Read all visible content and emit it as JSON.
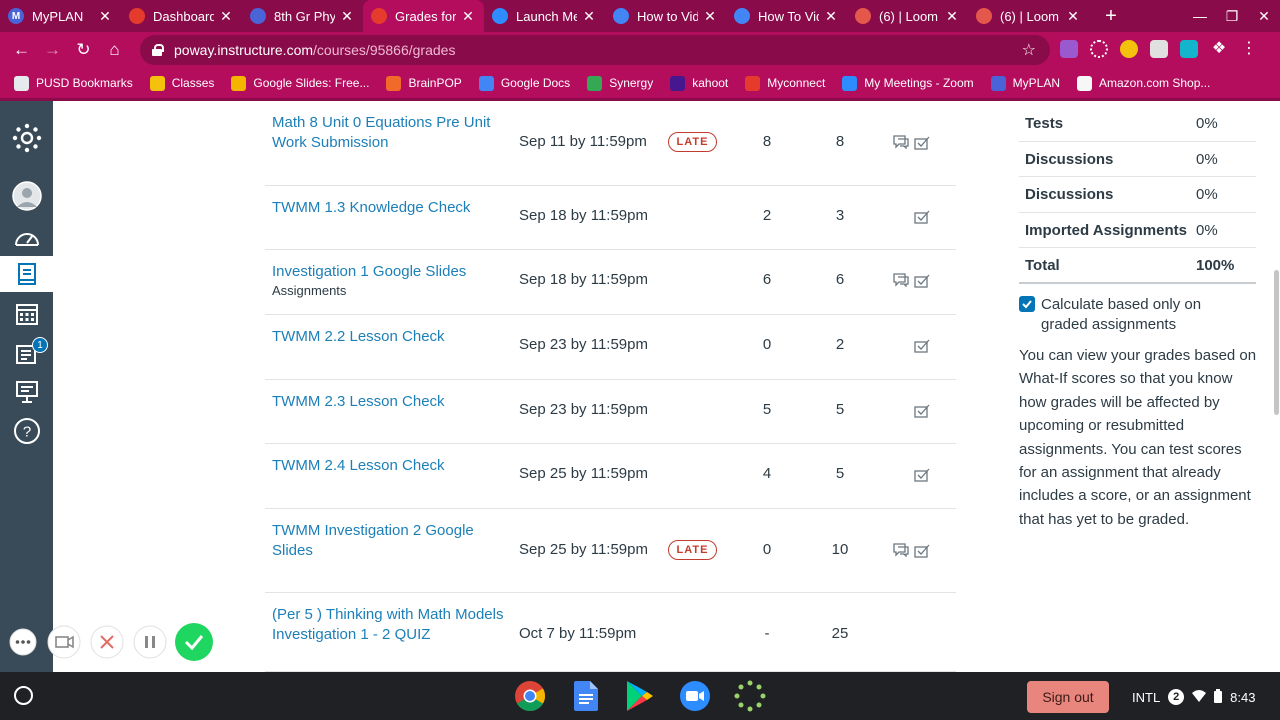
{
  "browser": {
    "tabs": [
      {
        "title": "MyPLAN",
        "icon_color": "#4a63d6",
        "glyph": "M"
      },
      {
        "title": "Dashboard",
        "icon_color": "#e43b2c",
        "glyph": ""
      },
      {
        "title": "8th Gr Phy",
        "icon_color": "#4a63d6",
        "glyph": ""
      },
      {
        "title": "Grades for",
        "icon_color": "#e43b2c",
        "glyph": ""
      },
      {
        "title": "Launch Me",
        "icon_color": "#2d8cff",
        "glyph": ""
      },
      {
        "title": "How to Vid",
        "icon_color": "#4285f4",
        "glyph": ""
      },
      {
        "title": "How To Vid",
        "icon_color": "#4285f4",
        "glyph": ""
      },
      {
        "title": "(6) | Loom",
        "icon_color": "#e4574b",
        "glyph": ""
      },
      {
        "title": "(6) | Loom",
        "icon_color": "#e4574b",
        "glyph": ""
      }
    ],
    "active_tab_index": 3,
    "url_host": "poway.instructure.com",
    "url_path": "/courses/95866/grades",
    "bookmarks": [
      {
        "label": "PUSD Bookmarks",
        "icon_color": "#e7eaed"
      },
      {
        "label": "Classes",
        "icon_color": "#f4c20d"
      },
      {
        "label": "Google Slides: Free...",
        "icon_color": "#f4b400"
      },
      {
        "label": "BrainPOP",
        "icon_color": "#f26a2a"
      },
      {
        "label": "Google Docs",
        "icon_color": "#4285f4"
      },
      {
        "label": "Synergy",
        "icon_color": "#34a853"
      },
      {
        "label": "kahoot",
        "icon_color": "#46178f"
      },
      {
        "label": "Myconnect",
        "icon_color": "#e43b2c"
      },
      {
        "label": "My Meetings - Zoom",
        "icon_color": "#2d8cff"
      },
      {
        "label": "MyPLAN",
        "icon_color": "#4a63d6"
      },
      {
        "label": "Amazon.com Shop...",
        "icon_color": "#f7f7f7"
      }
    ]
  },
  "grades": {
    "rows": [
      {
        "name": "Math 8 Unit 0 Equations Pre Unit Work Submission",
        "category": "",
        "due": "Sep 11 by 11:59pm",
        "status": "LATE",
        "score": "8",
        "out_of": "8",
        "has_comment": true
      },
      {
        "name": "TWMM 1.3 Knowledge Check",
        "category": "",
        "due": "Sep 18 by 11:59pm",
        "status": "",
        "score": "2",
        "out_of": "3",
        "has_comment": false
      },
      {
        "name": "Investigation 1 Google Slides",
        "category": "Assignments",
        "due": "Sep 18 by 11:59pm",
        "status": "",
        "score": "6",
        "out_of": "6",
        "has_comment": true
      },
      {
        "name": "TWMM 2.2 Lesson Check",
        "category": "",
        "due": "Sep 23 by 11:59pm",
        "status": "",
        "score": "0",
        "out_of": "2",
        "has_comment": false
      },
      {
        "name": "TWMM 2.3 Lesson Check",
        "category": "",
        "due": "Sep 23 by 11:59pm",
        "status": "",
        "score": "5",
        "out_of": "5",
        "has_comment": false
      },
      {
        "name": "TWMM 2.4 Lesson Check",
        "category": "",
        "due": "Sep 25 by 11:59pm",
        "status": "",
        "score": "4",
        "out_of": "5",
        "has_comment": false
      },
      {
        "name": "TWMM Investigation 2 Google Slides",
        "category": "",
        "due": "Sep 25 by 11:59pm",
        "status": "LATE",
        "score": "0",
        "out_of": "10",
        "has_comment": true
      },
      {
        "name": "(Per 5 ) Thinking with Math Models Investigation 1 - 2 QUIZ",
        "category": "",
        "due": "Oct 7 by 11:59pm",
        "status": "",
        "score": "-",
        "out_of": "25",
        "has_comment": false
      }
    ]
  },
  "weights": [
    {
      "name": "Tests",
      "value": "0%"
    },
    {
      "name": "Discussions",
      "value": "0%"
    },
    {
      "name": "Discussions",
      "value": "0%"
    },
    {
      "name": "Imported Assignments",
      "value": "0%"
    },
    {
      "name": "Total",
      "value": "100%"
    }
  ],
  "calc_label": "Calculate based only on graded assignments",
  "whatif_text": "You can view your grades based on What-If scores so that you know how grades will be affected by upcoming or resubmitted assignments. You can test scores for an assignment that already includes a score, or an assignment that has yet to be graded.",
  "nav_badge": "1",
  "shelf": {
    "sign_out": "Sign out",
    "ime": "INTL",
    "notif_count": "2",
    "time": "8:43"
  },
  "colors": {
    "chrome_dark": "#8a0b4a",
    "chrome": "#b40d5e",
    "canvas_nav": "#394b58",
    "link": "#1d7fb8",
    "late": "#c23c2d",
    "loom_green": "#1fd760"
  }
}
